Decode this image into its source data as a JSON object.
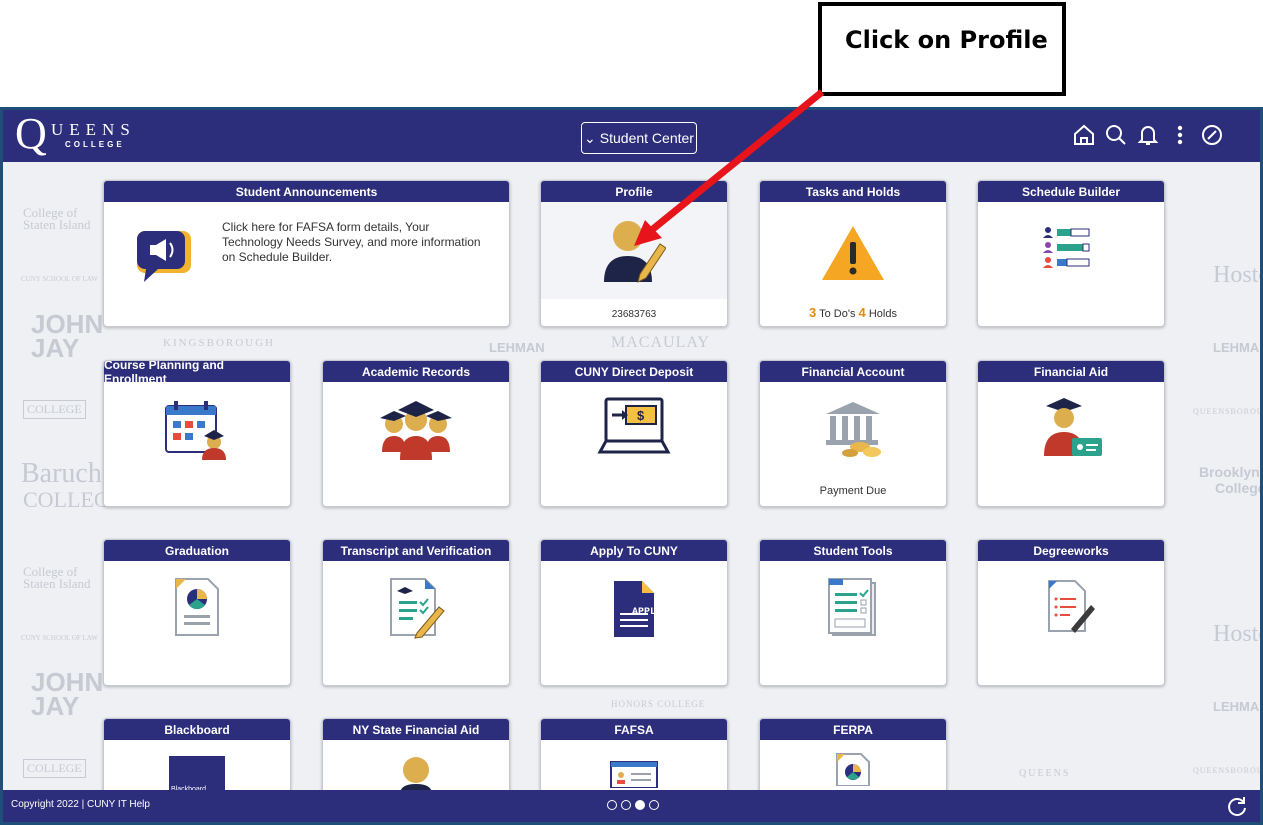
{
  "callout": {
    "text": "Click on Profile"
  },
  "header": {
    "logo_main": "UEENS",
    "logo_sub": "COLLEGE",
    "nav_label": "Student Center",
    "icons": [
      "home-icon",
      "search-icon",
      "bell-icon",
      "more-icon",
      "nav-compass-icon"
    ]
  },
  "tiles": {
    "announcements": {
      "title": "Student Announcements",
      "text": "Click here for FAFSA form details, Your Technology Needs Survey, and more information on Schedule Builder."
    },
    "profile": {
      "title": "Profile",
      "id": "23683763"
    },
    "tasks": {
      "title": "Tasks and Holds",
      "todo_count": "3",
      "todo_label": "To Do's",
      "holds_count": "4",
      "holds_label": "Holds"
    },
    "schedule": {
      "title": "Schedule Builder"
    },
    "course": {
      "title": "Course Planning and Enrollment"
    },
    "academic": {
      "title": "Academic Records"
    },
    "deposit": {
      "title": "CUNY Direct Deposit"
    },
    "account": {
      "title": "Financial Account",
      "caption": "Payment Due"
    },
    "aid": {
      "title": "Financial Aid"
    },
    "graduation": {
      "title": "Graduation"
    },
    "transcript": {
      "title": "Transcript and Verification"
    },
    "apply": {
      "title": "Apply To CUNY",
      "icon_text": "APPLY"
    },
    "tools": {
      "title": "Student Tools"
    },
    "degree": {
      "title": "Degreeworks"
    },
    "blackboard": {
      "title": "Blackboard",
      "icon_text": "Blackboard"
    },
    "nysaid": {
      "title": "NY State Financial Aid"
    },
    "fafsa": {
      "title": "FAFSA"
    },
    "ferpa": {
      "title": "FERPA"
    }
  },
  "watermarks": {
    "csi": "College of Staten Island",
    "cuny_law": "CUNY SCHOOL OF LAW",
    "hostos": "Hostos",
    "john_jay": "JOHN JAY",
    "kingsborough": "KINGSBOROUGH",
    "lehman": "LEHMAN",
    "macaulay": "MACAULAY",
    "baruch": "Baruch",
    "baruch_sub": "COLLEGE",
    "queensborough": "QUEENSBOROUGH",
    "brooklyn": "Brooklyn",
    "brooklyn_sub": "College",
    "medgar": "COLLEGE",
    "queens": "QUEENS",
    "honors": "HONORS COLLEGE"
  },
  "footer": {
    "copyright": "Copyright 2022  |  CUNY IT Help",
    "pages": 4,
    "active_page": 3
  },
  "colors": {
    "header": "#2c2d7b",
    "accent_gold": "#e8b64a",
    "arrow": "#e8141b",
    "teal": "#2ba38c"
  }
}
